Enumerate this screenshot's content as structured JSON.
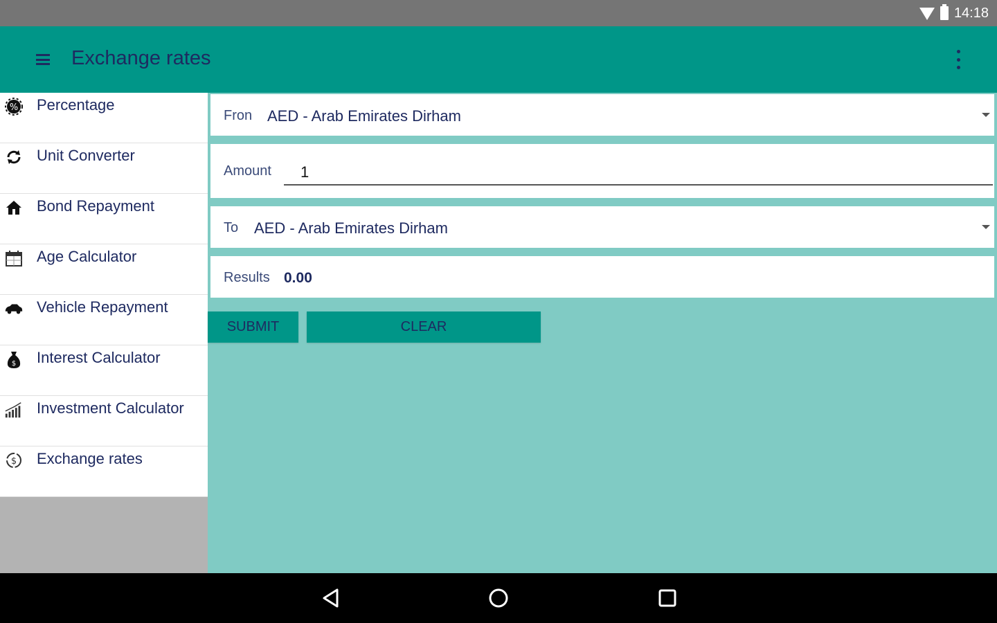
{
  "status_bar": {
    "time": "14:18",
    "icons": [
      "wifi-icon",
      "battery-icon"
    ]
  },
  "app_bar": {
    "title": "Exchange rates",
    "menu_icon": "hamburger-menu-icon",
    "overflow_icon": "more-vert-icon"
  },
  "drawer": {
    "items": [
      {
        "label": "Percentage",
        "icon": "percentage-icon"
      },
      {
        "label": "Unit Converter",
        "icon": "refresh-icon"
      },
      {
        "label": "Bond Repayment",
        "icon": "house-icon"
      },
      {
        "label": "Age Calculator",
        "icon": "calendar-icon"
      },
      {
        "label": "Vehicle Repayment",
        "icon": "car-icon"
      },
      {
        "label": "Interest Calculator",
        "icon": "money-bag-icon"
      },
      {
        "label": "Investment Calculator",
        "icon": "bar-chart-icon"
      },
      {
        "label": "Exchange rates",
        "icon": "currency-exchange-icon"
      }
    ]
  },
  "form": {
    "from": {
      "label": "Fron",
      "value": "AED - Arab Emirates Dirham"
    },
    "amount": {
      "label": "Amount",
      "value": "1"
    },
    "to": {
      "label": "To",
      "value": "AED - Arab Emirates Dirham"
    },
    "results": {
      "label": "Results",
      "value": "0.00"
    },
    "submit_label": "SUBMIT",
    "clear_label": "CLEAR"
  },
  "colors": {
    "primary": "#009688",
    "background": "#80cbc4",
    "text": "#1e2a60",
    "status_bar": "#757575",
    "nav_bar": "#000000"
  },
  "nav_bar": {
    "icons": [
      "back-icon",
      "home-icon",
      "recents-icon"
    ]
  }
}
